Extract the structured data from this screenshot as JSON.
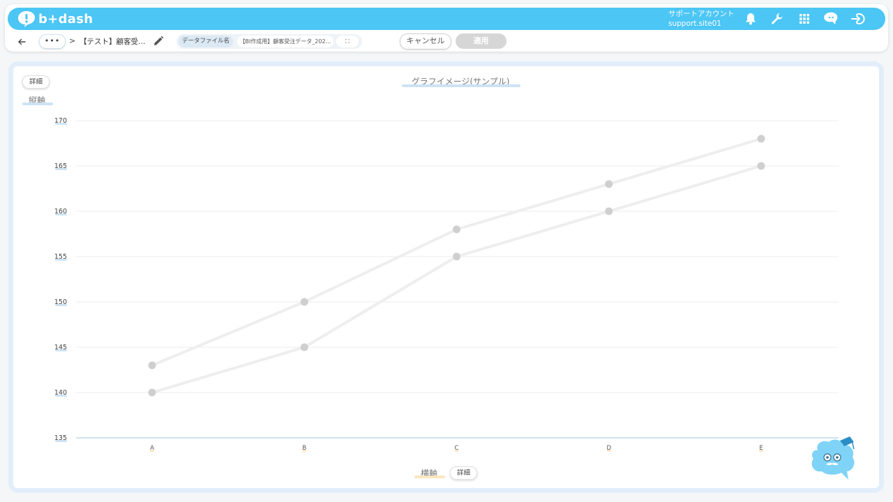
{
  "app": {
    "logo_text": "b+dash"
  },
  "account": {
    "line1": "サポートアカウント",
    "line2": "support.site01"
  },
  "toolbar": {
    "more_label": "•••",
    "breadcrumb_sep": ">",
    "title": "【テスト】顧客受…",
    "file_label": "データファイル名",
    "file_name": "【BI作成用】顧客受注データ_202…",
    "expand_label": "⛶",
    "cancel_label": "キャンセル",
    "apply_label": "適用"
  },
  "chart_panel": {
    "detail_top_label": "詳細",
    "detail_bottom_label": "詳細"
  },
  "icons": {
    "bell": "bell-icon",
    "wrench": "wrench-icon",
    "grid": "grid-icon",
    "assistant": "assistant-icon",
    "logout": "logout-icon"
  },
  "colors": {
    "accent": "#4cc6f5",
    "series": "#cfcfcf",
    "line": "#eeeeee",
    "apply_disabled": "#d6d6d6"
  },
  "chart_data": {
    "type": "line",
    "title": "グラフイメージ(サンプル)",
    "xlabel": "横軸",
    "ylabel": "縦軸",
    "categories": [
      "A",
      "B",
      "C",
      "D",
      "E"
    ],
    "series": [
      {
        "values": [
          143,
          150,
          158,
          163,
          168
        ]
      },
      {
        "values": [
          140,
          145,
          155,
          160,
          165
        ]
      }
    ],
    "ylim": [
      135,
      170
    ],
    "yticks": [
      135,
      140,
      145,
      150,
      155,
      160,
      165,
      170
    ],
    "grid": true
  }
}
